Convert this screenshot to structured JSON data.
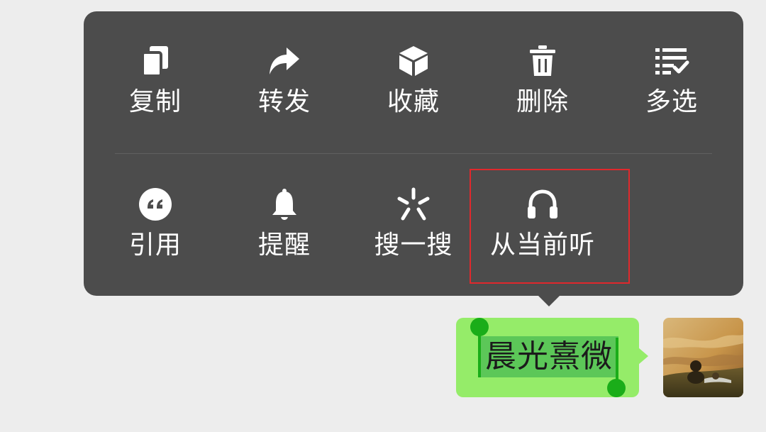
{
  "menu": {
    "items": [
      {
        "label": "复制",
        "icon": "copy-icon"
      },
      {
        "label": "转发",
        "icon": "forward-icon"
      },
      {
        "label": "收藏",
        "icon": "favorite-cube-icon"
      },
      {
        "label": "删除",
        "icon": "trash-icon"
      },
      {
        "label": "多选",
        "icon": "multiselect-list-icon"
      },
      {
        "label": "引用",
        "icon": "quote-icon"
      },
      {
        "label": "提醒",
        "icon": "bell-icon"
      },
      {
        "label": "搜一搜",
        "icon": "search-spark-icon"
      },
      {
        "label": "从当前听",
        "icon": "headphones-icon"
      }
    ],
    "highlighted_item": "从当前听"
  },
  "message": {
    "text": "晨光熹微",
    "bubble_color": "#95ec69",
    "selection_color": "#5cc758"
  },
  "colors": {
    "background": "#ededed",
    "menu_background": "#4c4c4c",
    "highlight_border": "#e0282c",
    "handle": "#1aad19"
  }
}
